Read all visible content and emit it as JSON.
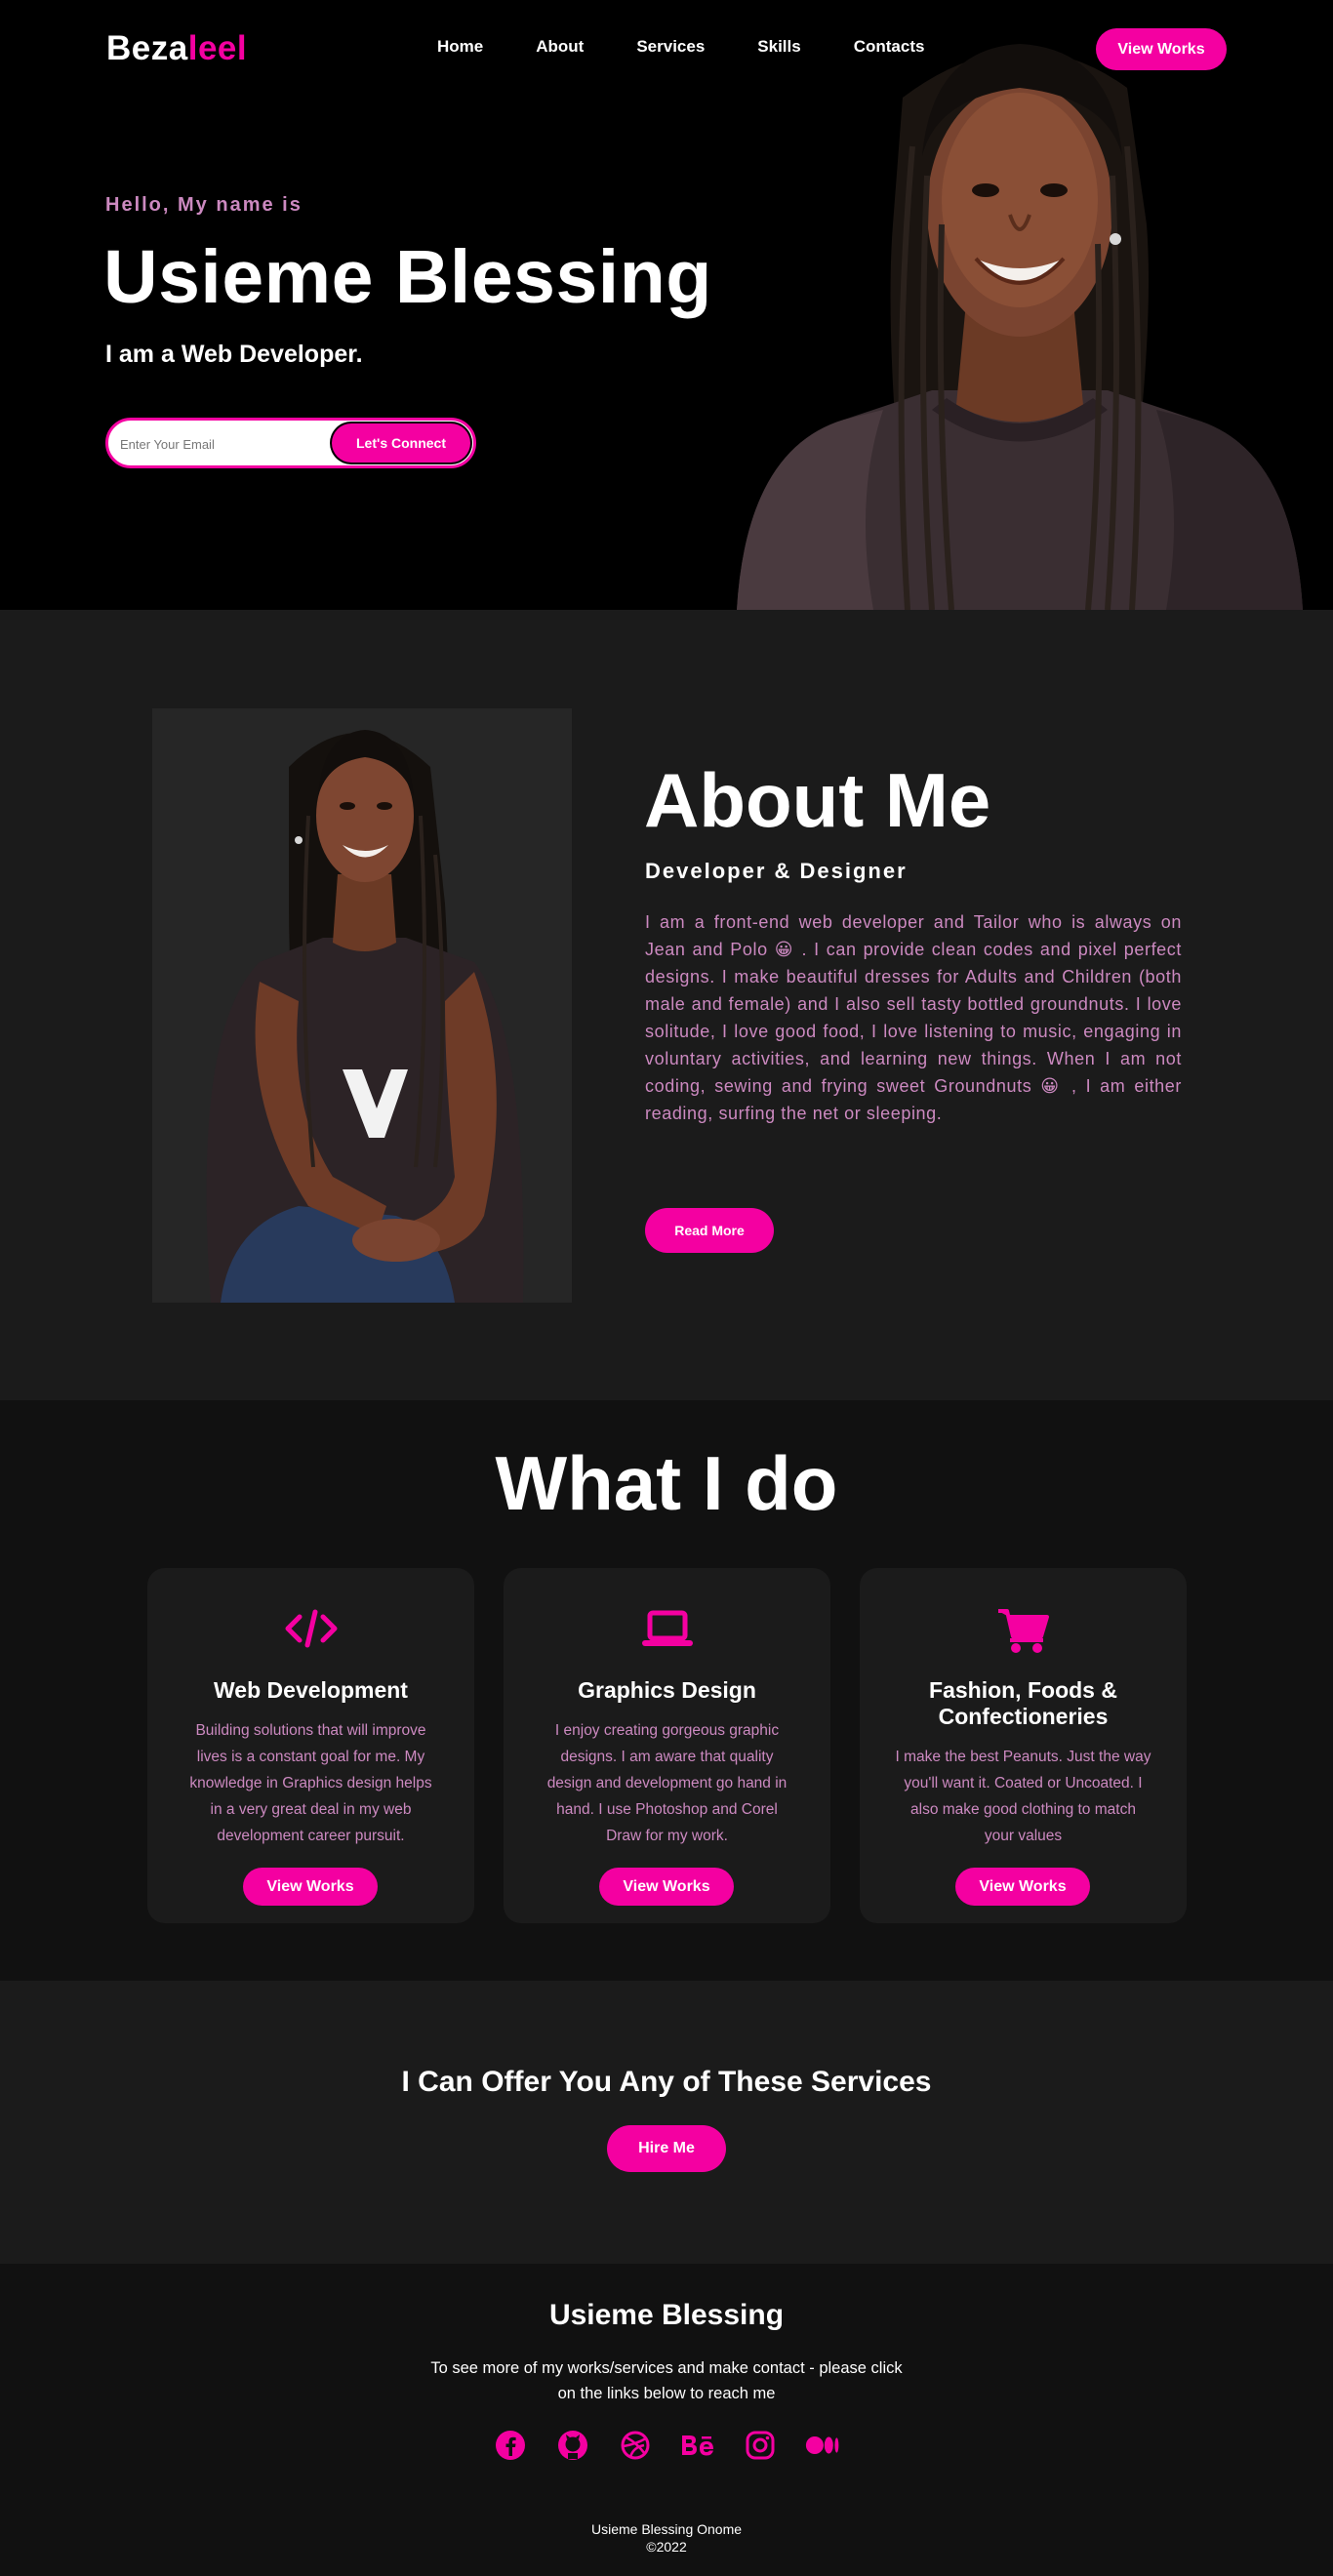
{
  "header": {
    "logo_first": "Beza",
    "logo_second": "leel",
    "nav": [
      "Home",
      "About",
      "Services",
      "Skills",
      "Contacts"
    ],
    "cta_label": "View Works"
  },
  "hero": {
    "greeting": "Hello, My name is",
    "name": "Usieme Blessing",
    "role": "I am a Web Developer.",
    "email_placeholder": "Enter Your Email",
    "connect_label": "Let's Connect"
  },
  "about": {
    "title": "About Me",
    "subtitle": "Developer & Designer",
    "text": "I am a front-end web developer and Tailor who is always on Jean and Polo 😀 . I can provide clean codes and pixel perfect designs. I make beautiful dresses for Adults and Children (both male and female) and I also sell tasty bottled groundnuts. I love solitude, I love good food, I love listening to music, engaging in voluntary activities, and learning new things. When I am not coding, sewing and frying sweet Groundnuts 😀 , I am either reading, surfing the net or sleeping.",
    "button_label": "Read More"
  },
  "what_i_do": {
    "title": "What I do",
    "cards": [
      {
        "icon": "code-icon",
        "title": "Web Development",
        "text": "Building solutions that will improve lives is a constant goal for me. My knowledge in Graphics design helps in a very great deal in my web development career pursuit.",
        "button_label": "View Works"
      },
      {
        "icon": "laptop-icon",
        "title": "Graphics Design",
        "text": "I enjoy creating gorgeous graphic designs. I am aware that quality design and development go hand in hand. I use Photoshop and Corel Draw for my work.",
        "button_label": "View Works"
      },
      {
        "icon": "cart-icon",
        "title": "Fashion, Foods & Confectioneries",
        "text": "I make the best Peanuts. Just the way you'll want it. Coated or Uncoated. I also make good clothing to match your values",
        "button_label": "View Works"
      }
    ]
  },
  "offer": {
    "title": "I Can Offer You Any of These Services",
    "button_label": "Hire Me"
  },
  "footer": {
    "name": "Usieme Blessing",
    "text": "To see more of my works/services and make contact - please click on the links below to reach me",
    "socials": [
      "facebook-icon",
      "github-icon",
      "dribbble-icon",
      "behance-icon",
      "instagram-icon",
      "medium-icon"
    ],
    "copyright_name": "Usieme Blessing Onome",
    "copyright_year": "©2022"
  },
  "colors": {
    "accent": "#f400a1",
    "muted_text": "#cc89c0",
    "hero_bg": "#000000",
    "section_bg": "#1b1b1b",
    "dark_bg": "#111111"
  }
}
